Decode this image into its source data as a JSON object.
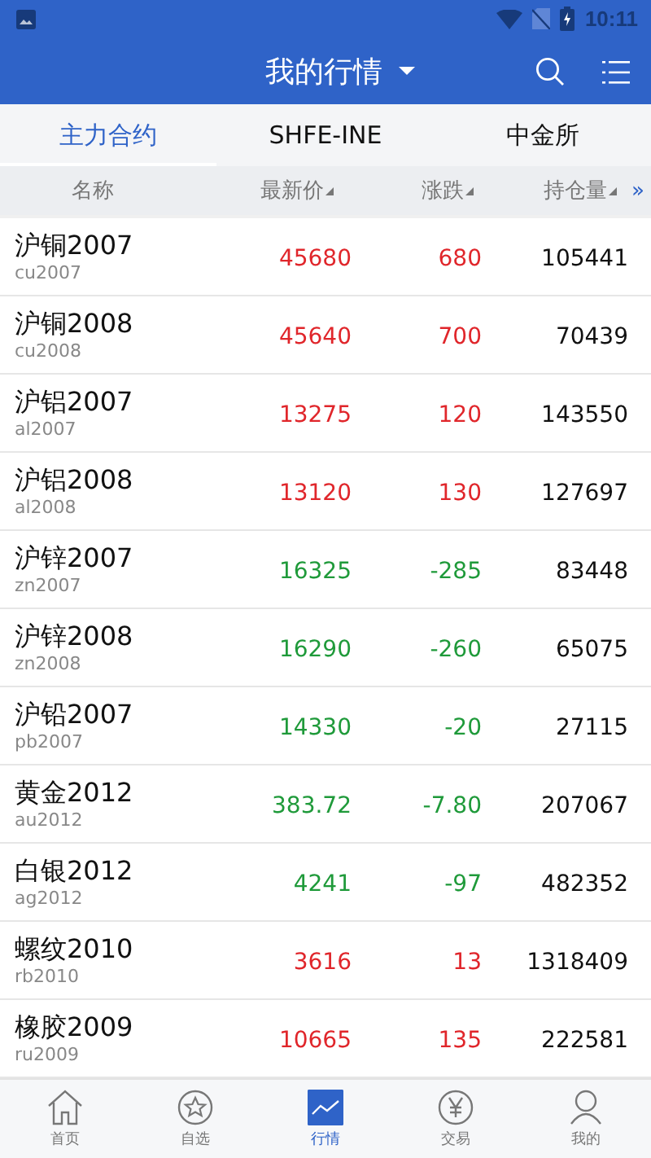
{
  "status_bar": {
    "time": "10:11"
  },
  "app_bar": {
    "title": "我的行情"
  },
  "tabs": [
    {
      "label": "主力合约",
      "selected": true
    },
    {
      "label": "SHFE-INE",
      "selected": false
    },
    {
      "label": "中金所",
      "selected": false
    }
  ],
  "table": {
    "columns": [
      {
        "label": "名称",
        "sortable": false
      },
      {
        "label": "最新价",
        "sortable": true
      },
      {
        "label": "涨跌",
        "sortable": true
      },
      {
        "label": "持仓量",
        "sortable": true
      }
    ],
    "more": "»",
    "rows": [
      {
        "name": "沪铜2007",
        "code": "cu2007",
        "price": "45680",
        "change": "680",
        "open_interest": "105441",
        "color": "#e0262b"
      },
      {
        "name": "沪铜2008",
        "code": "cu2008",
        "price": "45640",
        "change": "700",
        "open_interest": "70439",
        "color": "#e0262b"
      },
      {
        "name": "沪铝2007",
        "code": "al2007",
        "price": "13275",
        "change": "120",
        "open_interest": "143550",
        "color": "#e0262b"
      },
      {
        "name": "沪铝2008",
        "code": "al2008",
        "price": "13120",
        "change": "130",
        "open_interest": "127697",
        "color": "#e0262b"
      },
      {
        "name": "沪锌2007",
        "code": "zn2007",
        "price": "16325",
        "change": "-285",
        "open_interest": "83448",
        "color": "#1f9a3a"
      },
      {
        "name": "沪锌2008",
        "code": "zn2008",
        "price": "16290",
        "change": "-260",
        "open_interest": "65075",
        "color": "#1f9a3a"
      },
      {
        "name": "沪铅2007",
        "code": "pb2007",
        "price": "14330",
        "change": "-20",
        "open_interest": "27115",
        "color": "#1f9a3a"
      },
      {
        "name": "黄金2012",
        "code": "au2012",
        "price": "383.72",
        "change": "-7.80",
        "open_interest": "207067",
        "color": "#1f9a3a"
      },
      {
        "name": "白银2012",
        "code": "ag2012",
        "price": "4241",
        "change": "-97",
        "open_interest": "482352",
        "color": "#1f9a3a"
      },
      {
        "name": "螺纹2010",
        "code": "rb2010",
        "price": "3616",
        "change": "13",
        "open_interest": "1318409",
        "color": "#e0262b"
      },
      {
        "name": "橡胶2009",
        "code": "ru2009",
        "price": "10665",
        "change": "135",
        "open_interest": "222581",
        "color": "#e0262b"
      }
    ]
  },
  "bottom_nav": [
    {
      "label": "首页",
      "kind": "home",
      "selected": false
    },
    {
      "label": "自选",
      "kind": "star",
      "selected": false
    },
    {
      "label": "行情",
      "kind": "chart",
      "selected": true
    },
    {
      "label": "交易",
      "kind": "yen",
      "selected": false
    },
    {
      "label": "我的",
      "kind": "person",
      "selected": false
    }
  ]
}
